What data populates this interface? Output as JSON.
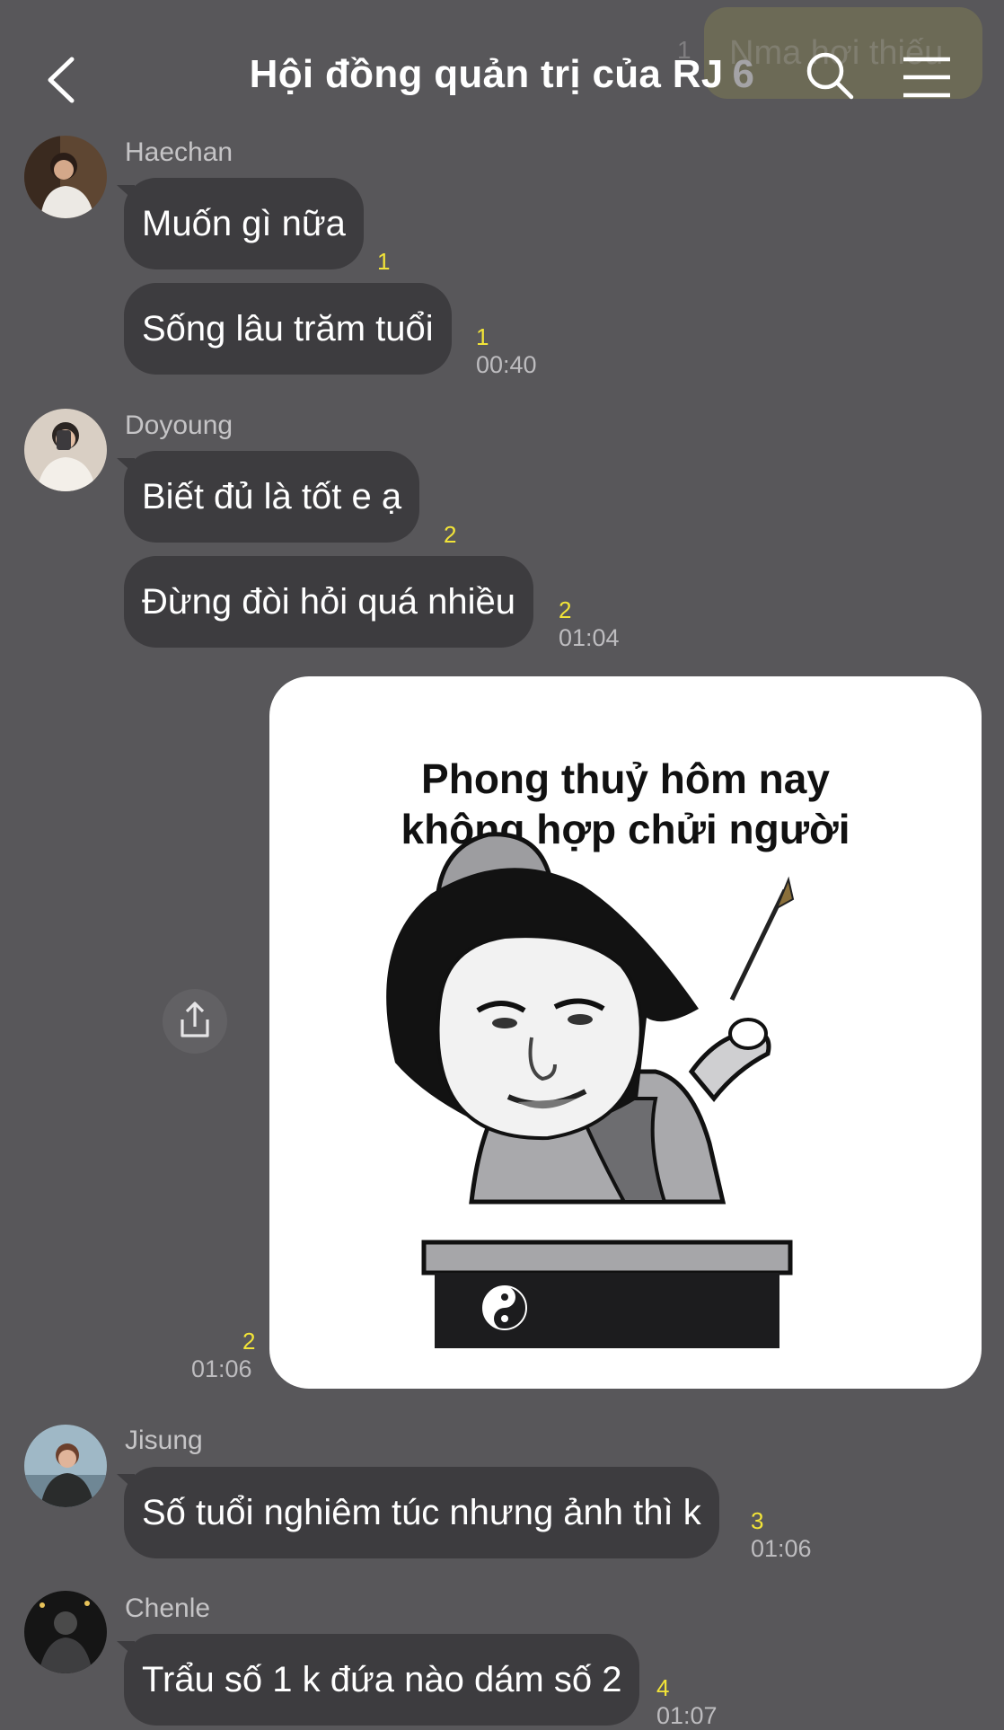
{
  "header": {
    "title": "Hội đồng quản trị của RJ",
    "member_count": "6",
    "background_preview_text": "Nma hơi thiếu",
    "background_preview_count": "1"
  },
  "messages": [
    {
      "sender": "Haechan",
      "bubbles": [
        {
          "text": "Muốn gì nữa",
          "unread": "1"
        },
        {
          "text": "Sống lâu trăm tuổi",
          "unread": "1",
          "time": "00:40"
        }
      ]
    },
    {
      "sender": "Doyoung",
      "bubbles": [
        {
          "text": "Biết đủ là tốt e ạ",
          "unread": "2"
        },
        {
          "text": "Đừng đòi hỏi quá nhiều",
          "unread": "2",
          "time": "01:04"
        }
      ]
    },
    {
      "sender": "me",
      "image": {
        "caption_line1": "Phong thuỷ hôm nay",
        "caption_line2": "không hợp chửi người",
        "unread": "2",
        "time": "01:06"
      }
    },
    {
      "sender": "Jisung",
      "bubbles": [
        {
          "text": "Số tuổi nghiêm túc nhưng ảnh thì k",
          "unread": "3",
          "time": "01:06"
        }
      ]
    },
    {
      "sender": "Chenle",
      "bubbles": [
        {
          "text": "Trẩu số 1 k đứa nào dám số 2",
          "unread": "4",
          "time": "01:07"
        }
      ]
    }
  ],
  "colors": {
    "background": "#58575a",
    "bubble": "#3d3c3f",
    "unread": "#f2e438"
  },
  "icons": [
    "back-chevron-icon",
    "search-icon",
    "menu-icon",
    "share-icon",
    "yin-yang-icon"
  ]
}
